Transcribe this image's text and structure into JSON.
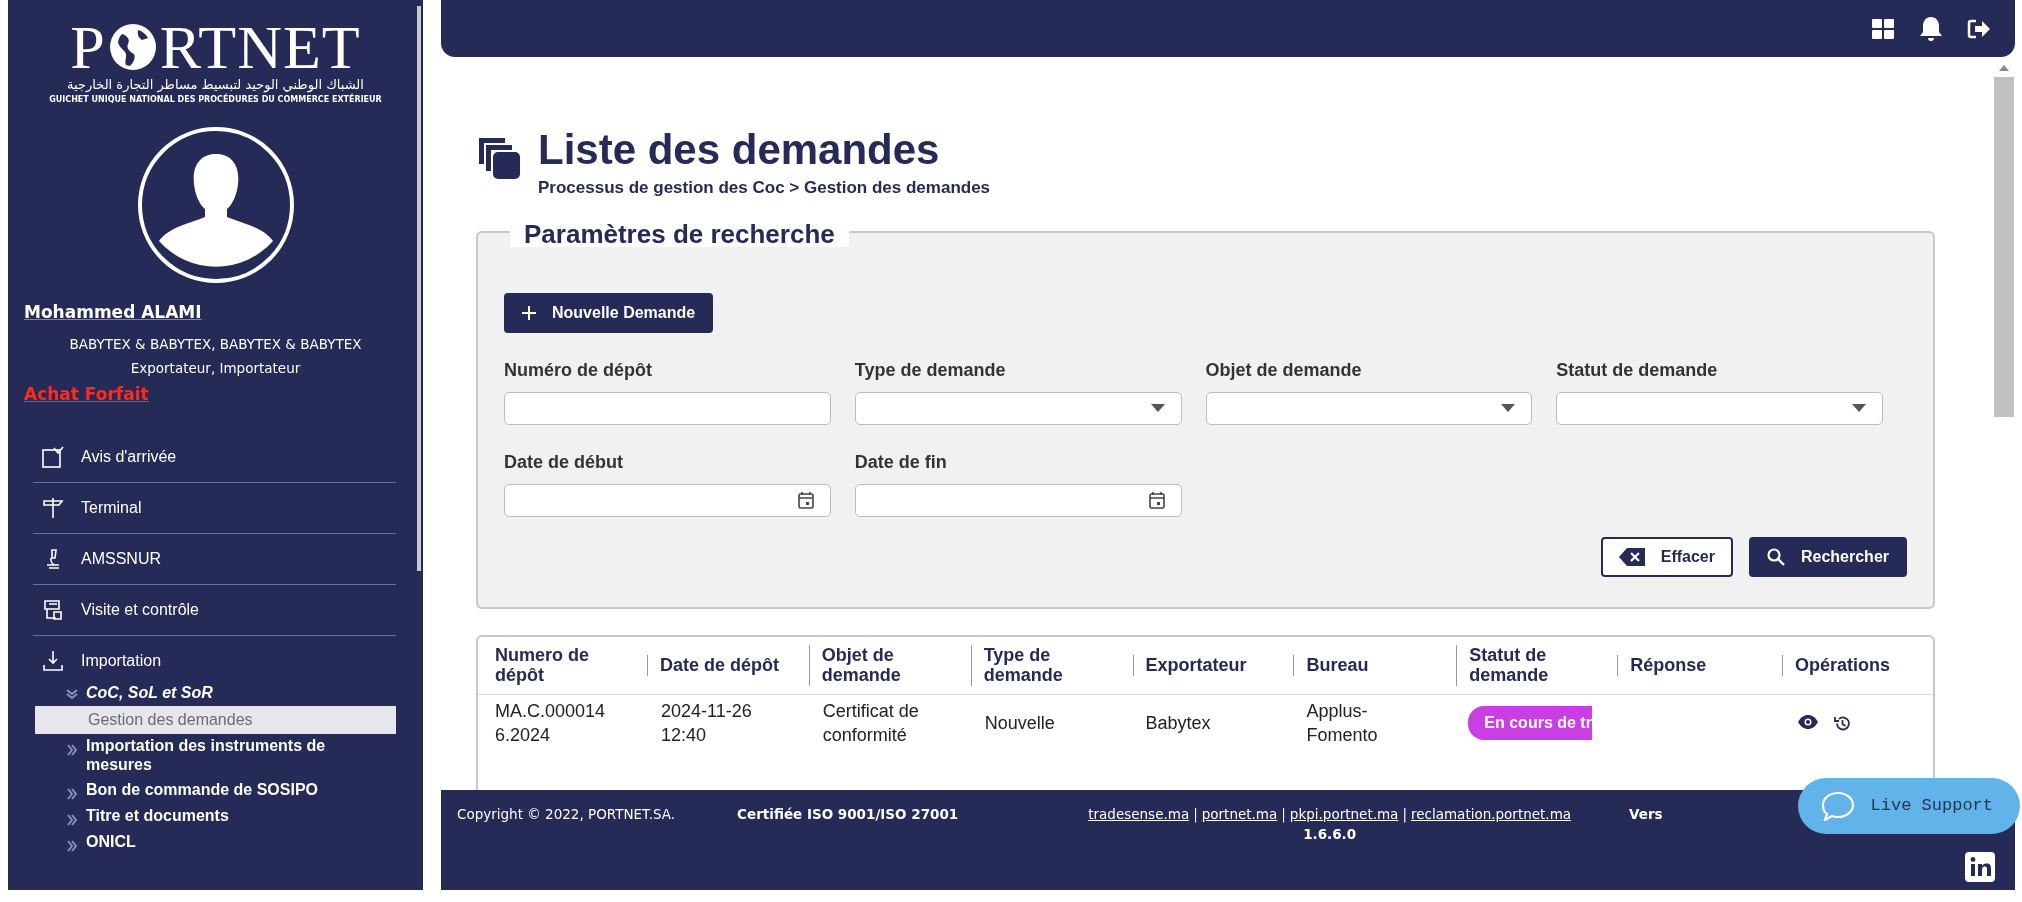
{
  "logo": {
    "text_before": "P",
    "text_after": "RTNET",
    "arabic": "الشباك الوطني الوحيد لتبسيط مساطر التجارة الخارجية",
    "subtitle": "GUICHET UNIQUE NATIONAL DES PROCÉDURES DU COMMERCE EXTÉRIEUR"
  },
  "user": {
    "name": "Mohammed ALAMI",
    "company": "BABYTEX & BABYTEX, BABYTEX & BABYTEX",
    "roles": "Exportateur, Importateur",
    "plan_link": "Achat Forfait"
  },
  "menu": [
    {
      "label": "Avis d'arrivée"
    },
    {
      "label": "Terminal"
    },
    {
      "label": "AMSSNUR"
    },
    {
      "label": "Visite et contrôle"
    },
    {
      "label": "Importation",
      "children": [
        {
          "label": "CoC, SoL et SoR",
          "expanded": true,
          "children": [
            {
              "label": "Gestion des demandes",
              "selected": true
            }
          ]
        },
        {
          "label": "Importation des instruments de mesures",
          "expanded": false
        },
        {
          "label": "Bon de commande de SOSIPO",
          "expanded": false
        },
        {
          "label": "Titre et documents",
          "expanded": false
        },
        {
          "label": "ONICL",
          "expanded": false
        }
      ]
    }
  ],
  "page": {
    "title": "Liste des demandes",
    "breadcrumb": "Processus de gestion des Coc > Gestion des demandes"
  },
  "search": {
    "legend": "Paramètres de recherche",
    "new_button": "Nouvelle Demande",
    "fields": [
      {
        "label": "Numéro de dépôt",
        "kind": "text"
      },
      {
        "label": "Type de demande",
        "kind": "select"
      },
      {
        "label": "Objet de demande",
        "kind": "select"
      },
      {
        "label": "Statut de demande",
        "kind": "select"
      },
      {
        "label": "Date de début",
        "kind": "date"
      },
      {
        "label": "Date de fin",
        "kind": "date"
      }
    ],
    "buttons": [
      {
        "label": "Effacer",
        "kind": "clear"
      },
      {
        "label": "Rechercher",
        "kind": "search"
      }
    ]
  },
  "table": {
    "columns": [
      "Numero de dépôt",
      "Date de dépôt",
      "Objet de demande",
      "Type de demande",
      "Exportateur",
      "Bureau",
      "Statut de demande",
      "Réponse",
      "Opérations"
    ],
    "rows": [
      {
        "numero": "MA.C.0000146.2024",
        "date": "2024-11-26 12:40",
        "objet": "Certificat de conformité",
        "type": "Nouvelle",
        "exportateur": "Babytex",
        "bureau": "Applus-Fomento",
        "statut": {
          "label": "En cours de tr",
          "color": "#c93fe3"
        }
      }
    ]
  },
  "footer": {
    "copyright": "Copyright © 2022, PORTNET.SA.",
    "certification": "Certifiée ISO 9001/ISO 27001",
    "links": [
      "tradesense.ma",
      "portnet.ma",
      "pkpi.portnet.ma",
      "reclamation.portnet.ma"
    ],
    "separator": "|",
    "version": "1.6.6.0",
    "version_label": "Vers"
  },
  "live_support": {
    "label": "Live Support"
  }
}
